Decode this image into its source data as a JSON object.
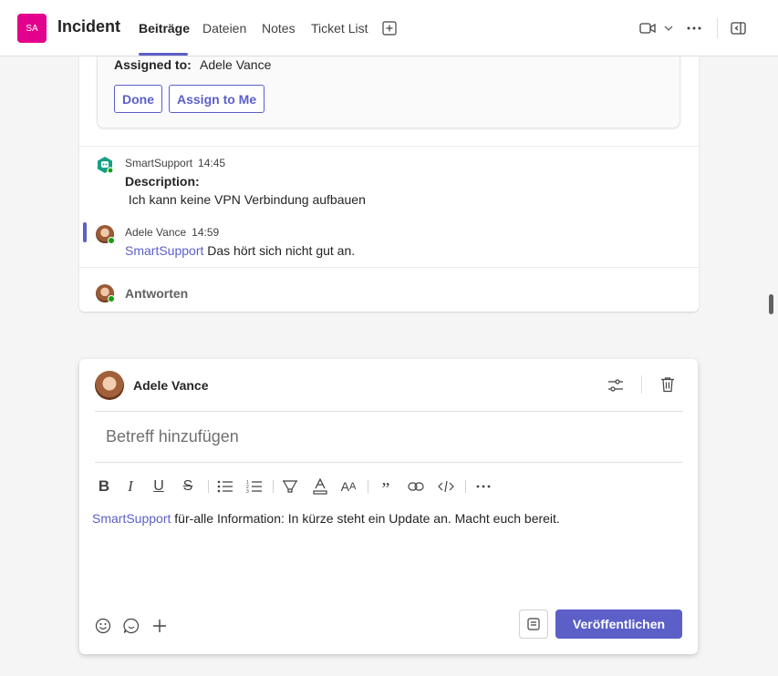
{
  "header": {
    "avatar_initials": "SA",
    "title": "Incident",
    "tabs": [
      {
        "label": "Beiträge",
        "active": true
      },
      {
        "label": "Dateien"
      },
      {
        "label": "Notes"
      },
      {
        "label": "Ticket List"
      }
    ]
  },
  "card": {
    "assigned_label": "Assigned to:",
    "assigned_value": "Adele Vance",
    "done_label": "Done",
    "assign_label": "Assign to Me"
  },
  "messages": [
    {
      "author": "SmartSupport",
      "time": "14:45",
      "title": "Description:",
      "body": " Ich kann keine VPN Verbindung aufbauen"
    },
    {
      "author": "Adele Vance",
      "time": "14:59",
      "mention": "SmartSupport",
      "body": " Das hört sich nicht gut an."
    }
  ],
  "reply_label": "Antworten",
  "compose": {
    "author": "Adele Vance",
    "subject_placeholder": "Betreff hinzufügen",
    "mention": "SmartSupport",
    "body": " für-alle Information: In kürze steht ein Update an. Macht euch bereit.",
    "publish_label": "Veröffentlichen"
  },
  "colors": {
    "brand": "#5b5fc7",
    "avatar": "#e3008c",
    "presence": "#13a10e"
  }
}
